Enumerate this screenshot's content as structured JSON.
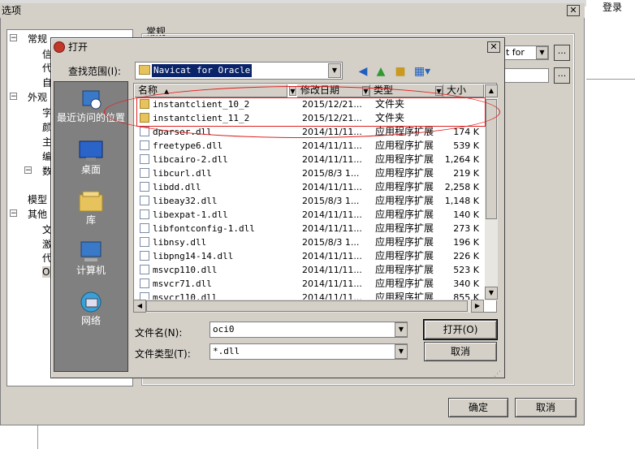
{
  "background": {
    "login_label": "登录"
  },
  "options_dialog": {
    "title": "选项",
    "section_title": "常规",
    "tree": [
      {
        "label": "常规",
        "expander": "−"
      },
      {
        "label": "信",
        "expander": ""
      },
      {
        "label": "代",
        "expander": ""
      },
      {
        "label": "自",
        "expander": ""
      },
      {
        "label": "外观",
        "expander": "−"
      },
      {
        "label": "字",
        "expander": ""
      },
      {
        "label": "颜",
        "expander": ""
      },
      {
        "label": "主",
        "expander": ""
      },
      {
        "label": "编",
        "expander": ""
      },
      {
        "label": "数",
        "expander": "−"
      },
      {
        "label": "模型",
        "expander": ""
      },
      {
        "label": "其他",
        "expander": "−"
      },
      {
        "label": "文",
        "expander": ""
      },
      {
        "label": "激",
        "expander": ""
      },
      {
        "label": "代",
        "expander": ""
      },
      {
        "label": "OC",
        "expander": ""
      }
    ],
    "combo_value": "t for",
    "small_button_label": "...",
    "ok_label": "确定",
    "cancel_label": "取消"
  },
  "open_dialog": {
    "title": "打开",
    "look_in_label": "查找范围(I):",
    "look_in_value": "Navicat for Oracle",
    "places": [
      {
        "label": "最近访问的位置",
        "icon": "recent-places-icon"
      },
      {
        "label": "桌面",
        "icon": "desktop-icon"
      },
      {
        "label": "库",
        "icon": "library-icon"
      },
      {
        "label": "计算机",
        "icon": "computer-icon"
      },
      {
        "label": "网络",
        "icon": "network-icon"
      }
    ],
    "columns": {
      "name": "名称",
      "date": "修改日期",
      "type": "类型",
      "size": "大小"
    },
    "files": [
      {
        "name": "instantclient_10_2",
        "date": "2015/12/21...",
        "type": "文件夹",
        "size": "",
        "kind": "folder"
      },
      {
        "name": "instantclient_11_2",
        "date": "2015/12/21...",
        "type": "文件夹",
        "size": "",
        "kind": "folder"
      },
      {
        "name": "dparser.dll",
        "date": "2014/11/11...",
        "type": "应用程序扩展",
        "size": "174 K",
        "kind": "dll"
      },
      {
        "name": "freetype6.dll",
        "date": "2014/11/11...",
        "type": "应用程序扩展",
        "size": "539 K",
        "kind": "dll"
      },
      {
        "name": "libcairo-2.dll",
        "date": "2014/11/11...",
        "type": "应用程序扩展",
        "size": "1,264 K",
        "kind": "dll"
      },
      {
        "name": "libcurl.dll",
        "date": "2015/8/3 1...",
        "type": "应用程序扩展",
        "size": "219 K",
        "kind": "dll"
      },
      {
        "name": "libdd.dll",
        "date": "2014/11/11...",
        "type": "应用程序扩展",
        "size": "2,258 K",
        "kind": "dll"
      },
      {
        "name": "libeay32.dll",
        "date": "2015/8/3 1...",
        "type": "应用程序扩展",
        "size": "1,148 K",
        "kind": "dll"
      },
      {
        "name": "libexpat-1.dll",
        "date": "2014/11/11...",
        "type": "应用程序扩展",
        "size": "140 K",
        "kind": "dll"
      },
      {
        "name": "libfontconfig-1.dll",
        "date": "2014/11/11...",
        "type": "应用程序扩展",
        "size": "273 K",
        "kind": "dll"
      },
      {
        "name": "libnsy.dll",
        "date": "2015/8/3 1...",
        "type": "应用程序扩展",
        "size": "196 K",
        "kind": "dll"
      },
      {
        "name": "libpng14-14.dll",
        "date": "2014/11/11...",
        "type": "应用程序扩展",
        "size": "226 K",
        "kind": "dll"
      },
      {
        "name": "msvcp110.dll",
        "date": "2014/11/11...",
        "type": "应用程序扩展",
        "size": "523 K",
        "kind": "dll"
      },
      {
        "name": "msvcr71.dll",
        "date": "2014/11/11...",
        "type": "应用程序扩展",
        "size": "340 K",
        "kind": "dll"
      },
      {
        "name": "msvcr110.dll",
        "date": "2014/11/11...",
        "type": "应用程序扩展",
        "size": "855 K",
        "kind": "dll"
      }
    ],
    "filename_label": "文件名(N):",
    "filename_value": "oci0",
    "filetype_label": "文件类型(T):",
    "filetype_value": "*.dll",
    "open_label": "打开(O)",
    "cancel_label": "取消"
  },
  "colors": {
    "highlight": "#e02020",
    "selection": "#0a246a"
  }
}
